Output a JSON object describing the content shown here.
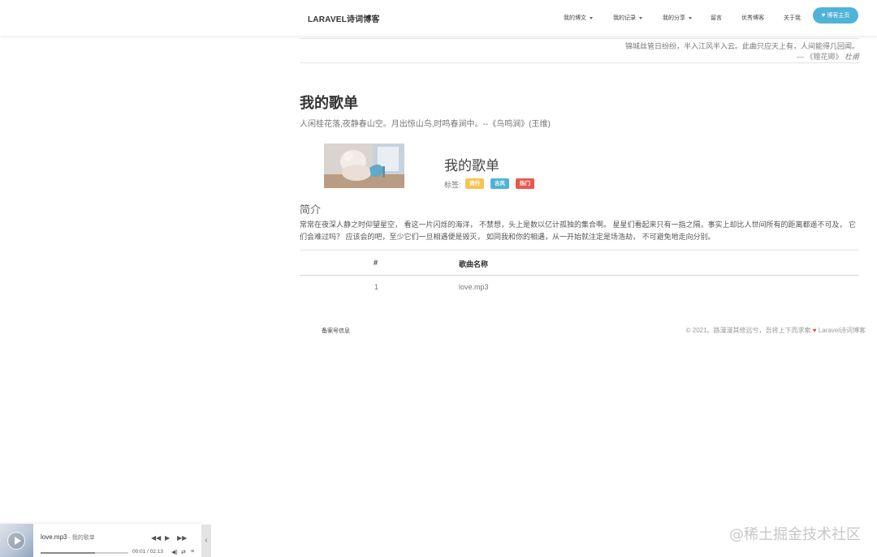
{
  "nav": {
    "brand": "LARAVEL诗词博客",
    "items": [
      {
        "label": "我的博文",
        "dropdown": true
      },
      {
        "label": "我的记录",
        "dropdown": true
      },
      {
        "label": "我的分享",
        "dropdown": true
      },
      {
        "label": "留言",
        "dropdown": false
      },
      {
        "label": "优秀博客",
        "dropdown": false
      },
      {
        "label": "关于我",
        "dropdown": false
      }
    ],
    "home_button": "博客主页"
  },
  "quote": {
    "text": "锦城丝管日纷纷，半入江风半入云。此曲只应天上有，人间能得几回闻。",
    "source_prefix": "— 《赠花卿》",
    "source_author": "杜甫"
  },
  "page": {
    "title": "我的歌单",
    "subtitle": "人闲桂花落,夜静春山空。月出惊山鸟,时鸣春涧中。--《鸟鸣涧》(王维)"
  },
  "playlist": {
    "cover_alt": "歌单封面",
    "title": "我的歌单",
    "tags_label": "标签:",
    "tags": [
      {
        "label": "流行",
        "color": "#f6c453"
      },
      {
        "label": "古风",
        "color": "#4fb3d9"
      },
      {
        "label": "热门",
        "color": "#e9594b"
      }
    ],
    "intro_title": "简介",
    "intro_text": "常常在夜深人静之时仰望星空， 看这一片闪烁的海洋， 不禁想，头上是数以亿计孤独的集合啊。 星星们看起来只有一指之隔，事实上却比人世间所有的距离都遥不可及， 它们会难过吗？ 应该会的吧，至少它们一旦相遇便是毁灭， 如同我和你的相遇，从一开始就注定是场浩劫， 不可避免地走向分别。"
  },
  "table": {
    "headers": [
      "#",
      "歌曲名称"
    ],
    "rows": [
      {
        "index": "1",
        "name": "love.mp3"
      }
    ]
  },
  "footer": {
    "left": "备案号信息",
    "right_prefix": "© 2021。路漫漫其修远兮，吾将上下而求索",
    "right_suffix": "Laravel诗词博客"
  },
  "player": {
    "song": "love.mp3",
    "artist": " - 我的歌单",
    "time": "00:01 / 02:13",
    "progress": 0.62,
    "toggle": "‹"
  },
  "watermark": "@稀土掘金技术社区"
}
